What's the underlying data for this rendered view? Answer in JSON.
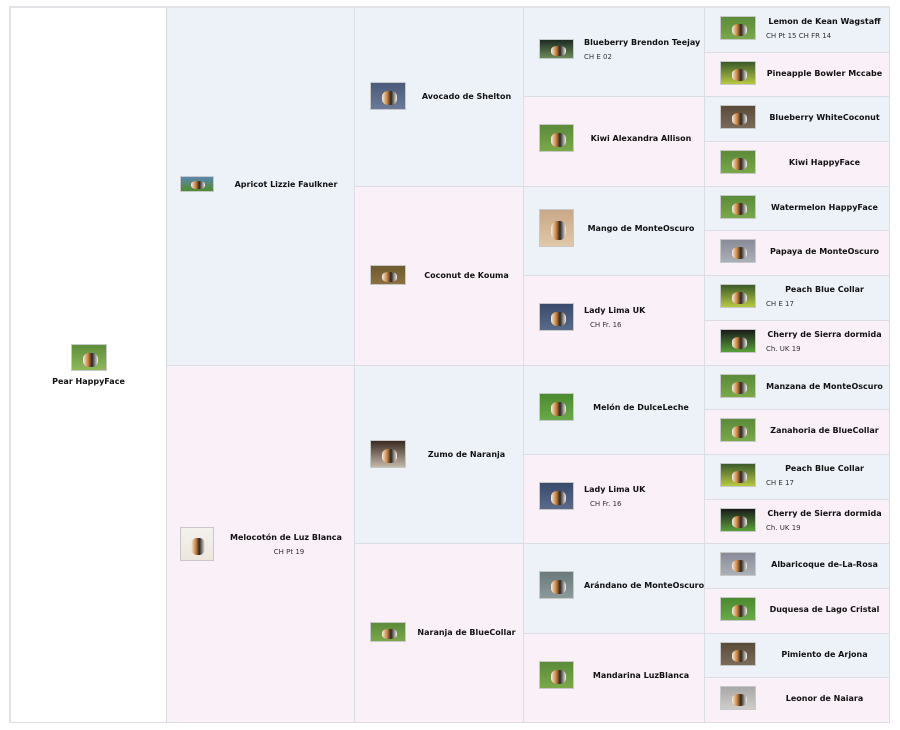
{
  "pedigree": {
    "root": {
      "name": "Pear HappyFace",
      "title": "",
      "photo": "grass-sitting-dog"
    },
    "gen1": [
      {
        "name": "Apricot Lizzie Faulkner",
        "title": "",
        "photo": "standing-dog-hill"
      },
      {
        "name": "Melocotón de Luz Blanca",
        "title": "CH Pt 19",
        "photo": "dog-head-white"
      }
    ],
    "gen2": [
      {
        "name": "Avocado de Shelton",
        "title": "",
        "photo": "dog-face-closeup"
      },
      {
        "name": "Coconut de Kouma",
        "title": "",
        "photo": "dog-sitting-brown"
      },
      {
        "name": "Zumo de Naranja",
        "title": "",
        "photo": "dog-portrait-dark"
      },
      {
        "name": "Naranja de BlueCollar",
        "title": "",
        "photo": "dog-standing-grass"
      }
    ],
    "gen3": [
      {
        "name": "Blueberry Brendon Teejay",
        "title": "CH E 02",
        "photo": "dog-show-dark"
      },
      {
        "name": "Kiwi Alexandra Allison",
        "title": "",
        "photo": "dog-standing-grass"
      },
      {
        "name": "Mango de MonteOscuro",
        "title": "",
        "photo": "puppy-indoor"
      },
      {
        "name": "Lady Lima UK",
        "title": "CH Fr. 16",
        "photo": "dog-face-ball"
      },
      {
        "name": "Melón de DulceLeche",
        "title": "",
        "photo": "dog-sitting-grass"
      },
      {
        "name": "Lady Lima UK",
        "title": "CH Fr. 16",
        "photo": "dog-face-ball"
      },
      {
        "name": "Arándano de MonteOscuro",
        "title": "",
        "photo": "dog-show-gray"
      },
      {
        "name": "Mandarina LuzBlanca",
        "title": "",
        "photo": "dog-standing-grass"
      }
    ],
    "gen4": [
      {
        "name": "Lemon de Kean Wagstaff",
        "title": "CH Pt 15 CH FR 14",
        "photo": "dog-standing-grass"
      },
      {
        "name": "Pineapple Bowler Mccabe",
        "title": "",
        "photo": "dog-garden"
      },
      {
        "name": "Blueberry WhiteCoconut",
        "title": "",
        "photo": "dog-standing-dirt"
      },
      {
        "name": "Kiwi HappyFace",
        "title": "",
        "photo": "dog-standing-grass"
      },
      {
        "name": "Watermelon HappyFace",
        "title": "",
        "photo": "dog-standing-grass"
      },
      {
        "name": "Papaya de MonteOscuro",
        "title": "",
        "photo": "dog-standing-gray"
      },
      {
        "name": "Peach Blue Collar",
        "title": "CH E 17",
        "photo": "dog-garden"
      },
      {
        "name": "Cherry de Sierra dormida",
        "title": "Ch. UK 19",
        "photo": "dog-show-grass"
      },
      {
        "name": "Manzana de MonteOscuro",
        "title": "",
        "photo": "dog-standing-grass"
      },
      {
        "name": "Zanahoria de BlueCollar",
        "title": "",
        "photo": "dog-standing-grass"
      },
      {
        "name": "Peach Blue Collar",
        "title": "CH E 17",
        "photo": "dog-garden"
      },
      {
        "name": "Cherry de Sierra dormida",
        "title": "Ch. UK 19",
        "photo": "dog-show-grass"
      },
      {
        "name": "Albaricoque de-La-Rosa",
        "title": "",
        "photo": "dog-standing-gray"
      },
      {
        "name": "Duquesa de Lago Cristal",
        "title": "",
        "photo": "dog-sitting-grass"
      },
      {
        "name": "Pimiento de Arjona",
        "title": "",
        "photo": "dog-standing-dirt"
      },
      {
        "name": "Leonor de Naiara",
        "title": "",
        "photo": "dog-head-gray"
      }
    ]
  },
  "colors": {
    "sire_bg": "#edf2f9",
    "dam_bg": "#faf0f8",
    "root_bg": "#ffffff",
    "border": "#dcdce4"
  }
}
